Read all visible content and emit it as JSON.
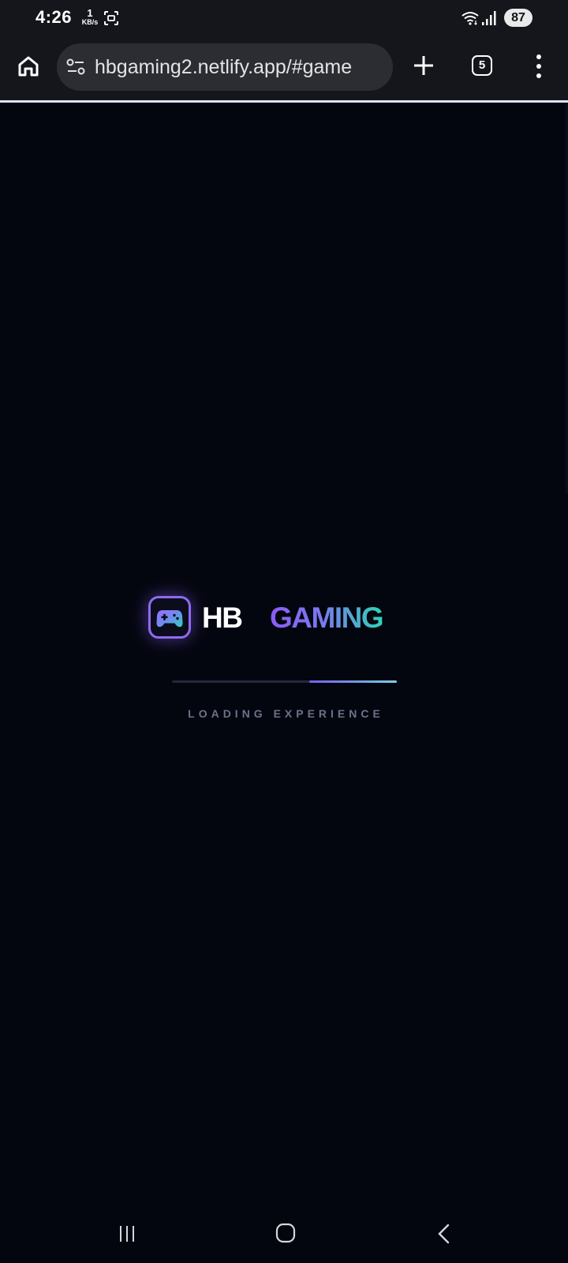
{
  "status_bar": {
    "time": "4:26",
    "net_speed_value": "1",
    "net_speed_unit": "KB/s",
    "battery": "87",
    "icons": [
      "screenshot-icon",
      "wifi-icon",
      "signal-icon",
      "battery-icon"
    ]
  },
  "browser": {
    "url": "hbgaming2.netlify.app/#game",
    "tab_count": "5",
    "icons": [
      "home-icon",
      "site-settings-icon",
      "plus-icon",
      "tab-switcher-icon",
      "more-vert-icon"
    ]
  },
  "loader": {
    "logo_icon": "gamepad-icon",
    "logo_primary": "HB",
    "logo_secondary": "GAMING",
    "status_text": "LOADING EXPERIENCE",
    "progress": {
      "start": 0.61,
      "end": 1.0
    },
    "colors": {
      "background": "#04060f",
      "accent_purple": "#8b5cf6",
      "accent_teal": "#2ed3b7",
      "text_muted": "#6b7389"
    }
  },
  "nav_bar": {
    "icons": [
      "recents-icon",
      "home-icon",
      "back-icon"
    ]
  }
}
